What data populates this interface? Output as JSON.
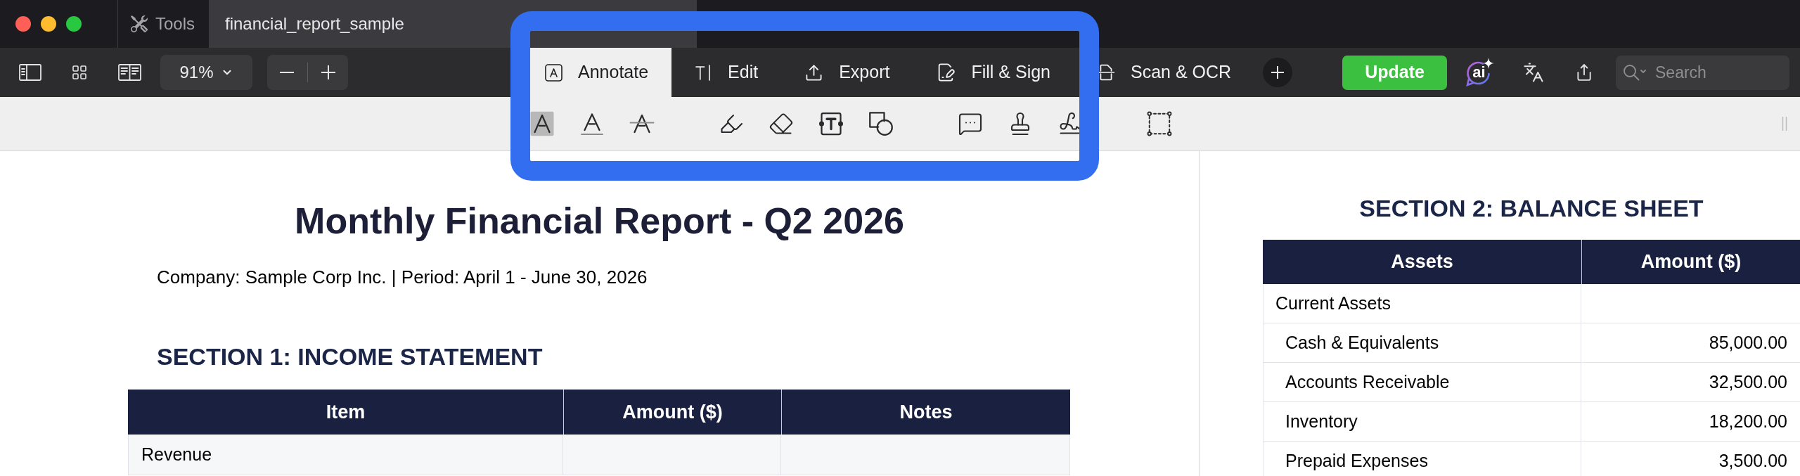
{
  "title_bar": {
    "tabs": [
      {
        "kind": "tools",
        "label": "Tools",
        "selected": false
      },
      {
        "kind": "document",
        "label": "financial_report_sample",
        "selected": true
      }
    ]
  },
  "toolbar": {
    "zoom": "91%",
    "mode_tabs": [
      {
        "kind": "annotate",
        "label": "Annotate",
        "selected": true
      },
      {
        "kind": "edit",
        "label": "Edit",
        "selected": false
      },
      {
        "kind": "export",
        "label": "Export",
        "selected": false
      },
      {
        "kind": "fill-sign",
        "label": "Fill & Sign",
        "selected": false
      },
      {
        "kind": "scan-ocr",
        "label": "Scan & OCR",
        "selected": false
      }
    ],
    "update_button": "Update",
    "ai_button": "ai",
    "search": {
      "placeholder": "Search"
    }
  },
  "annotation_toolbar": {
    "groups": [
      {
        "tools": [
          {
            "kind": "highlight"
          },
          {
            "kind": "underline"
          },
          {
            "kind": "strikethrough"
          }
        ]
      },
      {
        "tools": [
          {
            "kind": "highlighter"
          },
          {
            "kind": "eraser"
          },
          {
            "kind": "text-box"
          },
          {
            "kind": "shape"
          }
        ]
      },
      {
        "tools": [
          {
            "kind": "comment"
          },
          {
            "kind": "stamp"
          },
          {
            "kind": "signature"
          }
        ]
      },
      {
        "tools": [
          {
            "kind": "area-select"
          }
        ]
      }
    ]
  },
  "document": {
    "title": "Monthly Financial Report - Q2 2026",
    "subtitle": "Company: Sample Corp Inc. | Period: April 1 - June 30, 2026",
    "income_statement": {
      "heading": "SECTION 1: INCOME STATEMENT",
      "columns": [
        "Item",
        "Amount ($)",
        "Notes"
      ],
      "rows": [
        {
          "item": "Revenue"
        }
      ]
    },
    "balance_sheet": {
      "heading": "SECTION 2: BALANCE SHEET",
      "columns": [
        "Assets",
        "Amount ($)"
      ],
      "rows": [
        {
          "item": "Current Assets",
          "children": [
            {
              "item": "Cash & Equivalents",
              "amount": "85,000.00"
            },
            {
              "item": "Accounts Receivable",
              "amount": "32,500.00"
            },
            {
              "item": "Inventory",
              "amount": "18,200.00"
            },
            {
              "item": "Prepaid Expenses",
              "amount": "3,500.00"
            }
          ]
        }
      ]
    }
  }
}
